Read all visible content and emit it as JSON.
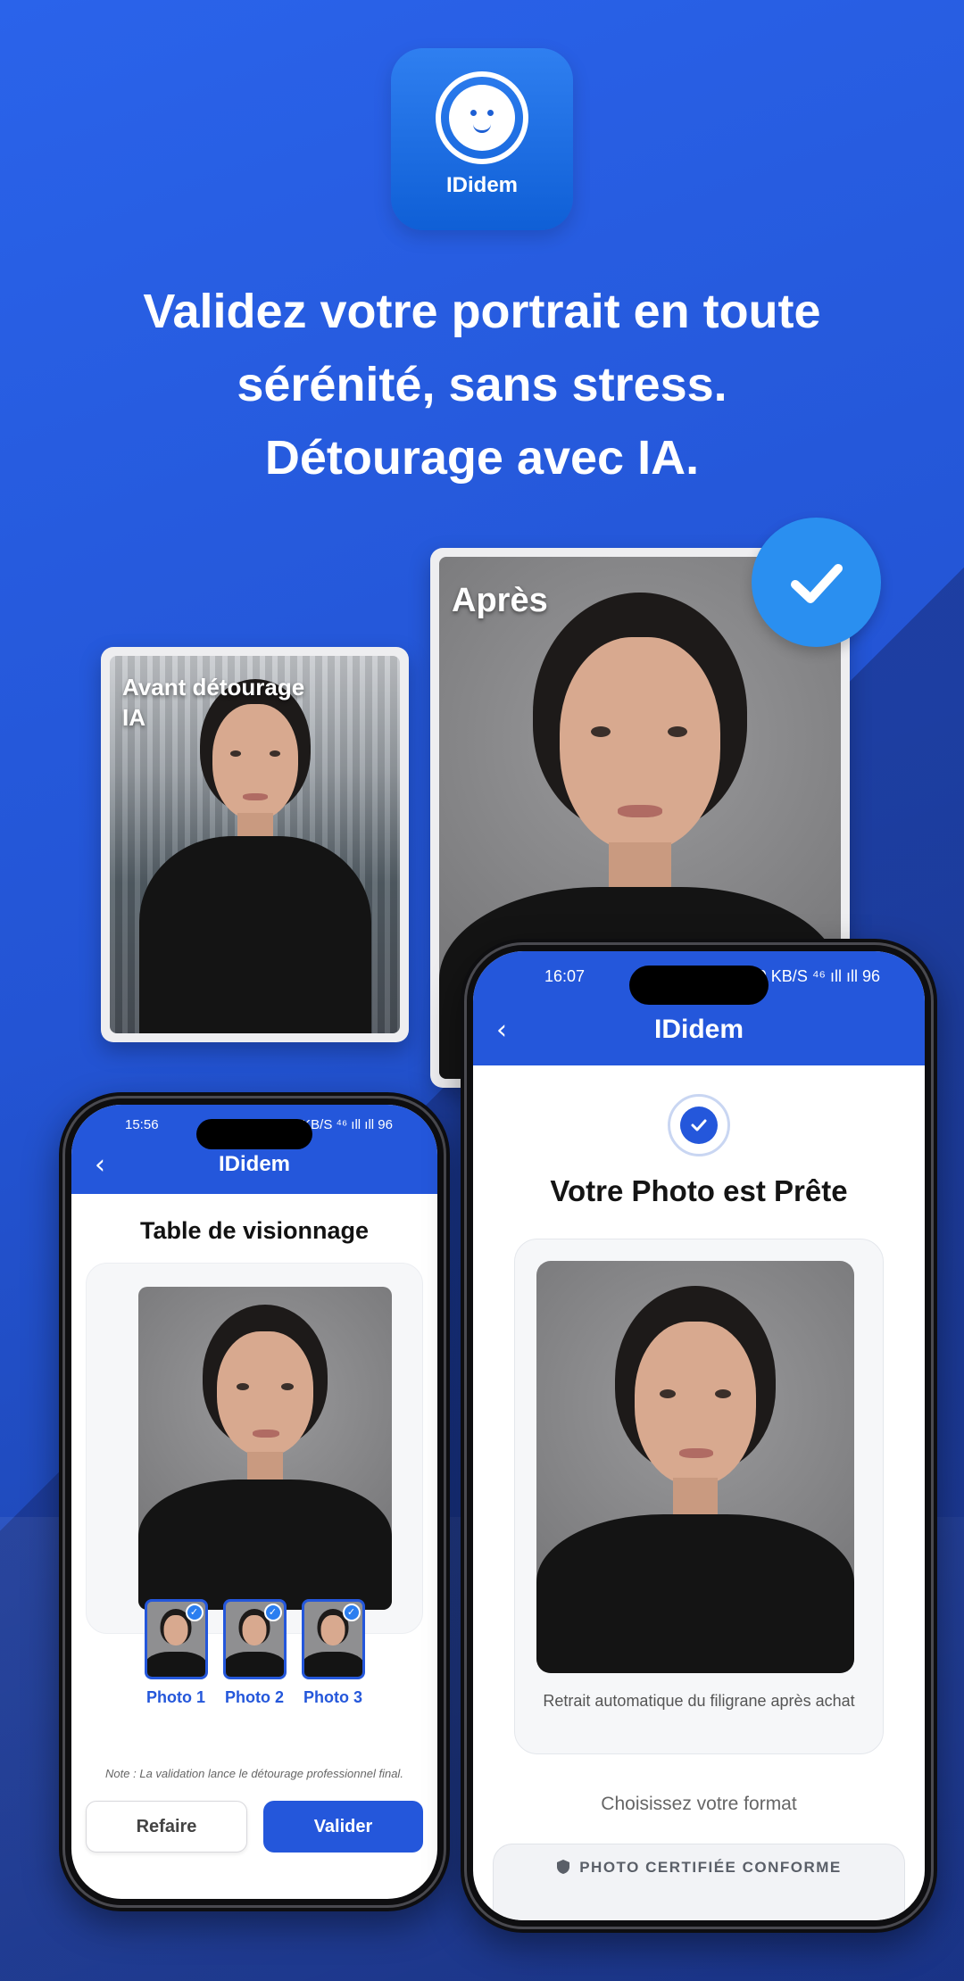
{
  "app": {
    "icon_label": "IDidem",
    "brand": "IDidem"
  },
  "headline": {
    "line1": "Validez votre portrait en toute",
    "line2": "sérénité, sans stress.",
    "line3": "Détourage avec IA."
  },
  "cards": {
    "before_label": "Avant détourage IA",
    "after_label": "Après"
  },
  "phone_left": {
    "status_time": "15:56",
    "status_right": "5,00 KB/S  ⁴⁶ ıll ıll 96",
    "title": "Table de visionnage",
    "thumbs": [
      {
        "label": "Photo 1"
      },
      {
        "label": "Photo 2"
      },
      {
        "label": "Photo 3"
      }
    ],
    "note": "Note : La validation lance le détourage professionnel final.",
    "btn_redo": "Refaire",
    "btn_validate": "Valider"
  },
  "phone_right": {
    "status_time": "16:07",
    "status_right": "2,00 KB/S  ⁴⁶ ıll ıll 96",
    "title": "Votre Photo est Prête",
    "photo_note": "Retrait automatique du filigrane après achat",
    "format_label": "Choisissez votre format",
    "certified_label": "PHOTO CERTIFIÉE CONFORME"
  },
  "colors": {
    "primary": "#2457db",
    "accent_check": "#2a8ff0",
    "background": "#2456d6"
  },
  "icons": [
    "smiley-icon",
    "check-icon",
    "back-chevron-icon",
    "shield-icon"
  ]
}
